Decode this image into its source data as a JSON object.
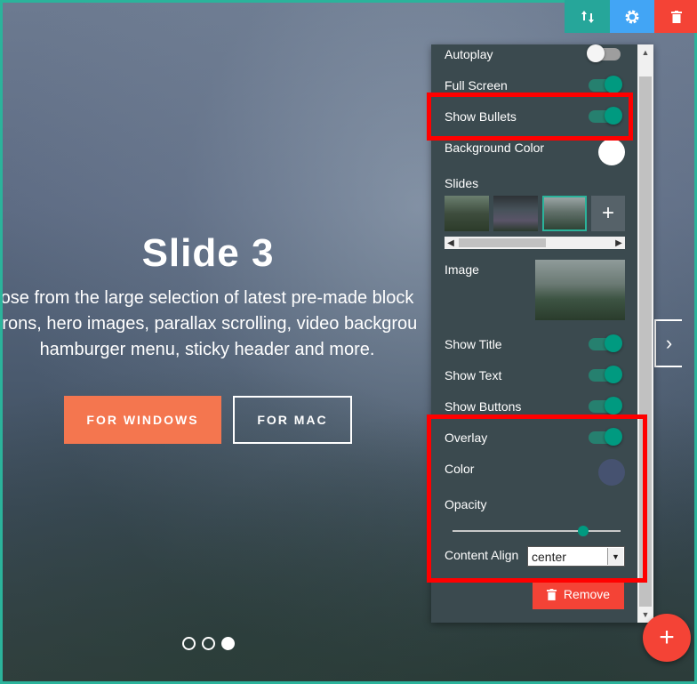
{
  "slide": {
    "title": "Slide 3",
    "text_lines": [
      "ose from the large selection of latest pre-made block",
      "trons, hero images, parallax scrolling, video backgrou",
      "hamburger menu, sticky header and more."
    ],
    "buttons": [
      "FOR WINDOWS",
      "FOR MAC"
    ],
    "bullets": [
      false,
      false,
      true
    ],
    "next_arrow": "›"
  },
  "toolbar": {
    "icons": [
      "sort-icon",
      "gear-icon",
      "trash-icon"
    ],
    "colors": [
      "#26a69a",
      "#42a5f5",
      "#f44336"
    ]
  },
  "panel": {
    "autoplay_label": "Autoplay",
    "autoplay_on": false,
    "fullscreen_label": "Full Screen",
    "fullscreen_on": true,
    "show_bullets_label": "Show Bullets",
    "show_bullets_on": true,
    "bg_color_label": "Background Color",
    "bg_color": "#ffffff",
    "slides_label": "Slides",
    "add_slide": "+",
    "image_label": "Image",
    "show_title_label": "Show Title",
    "show_title_on": true,
    "show_text_label": "Show Text",
    "show_text_on": true,
    "show_buttons_label": "Show Buttons",
    "show_buttons_on": true,
    "overlay_label": "Overlay",
    "overlay_on": true,
    "color_label": "Color",
    "overlay_color": "#465270",
    "opacity_label": "Opacity",
    "opacity_value": 0.75,
    "content_align_label": "Content Align",
    "content_align_value": "center",
    "remove_label": "Remove"
  },
  "fab_label": "+",
  "accent_color": "#2bb39b"
}
